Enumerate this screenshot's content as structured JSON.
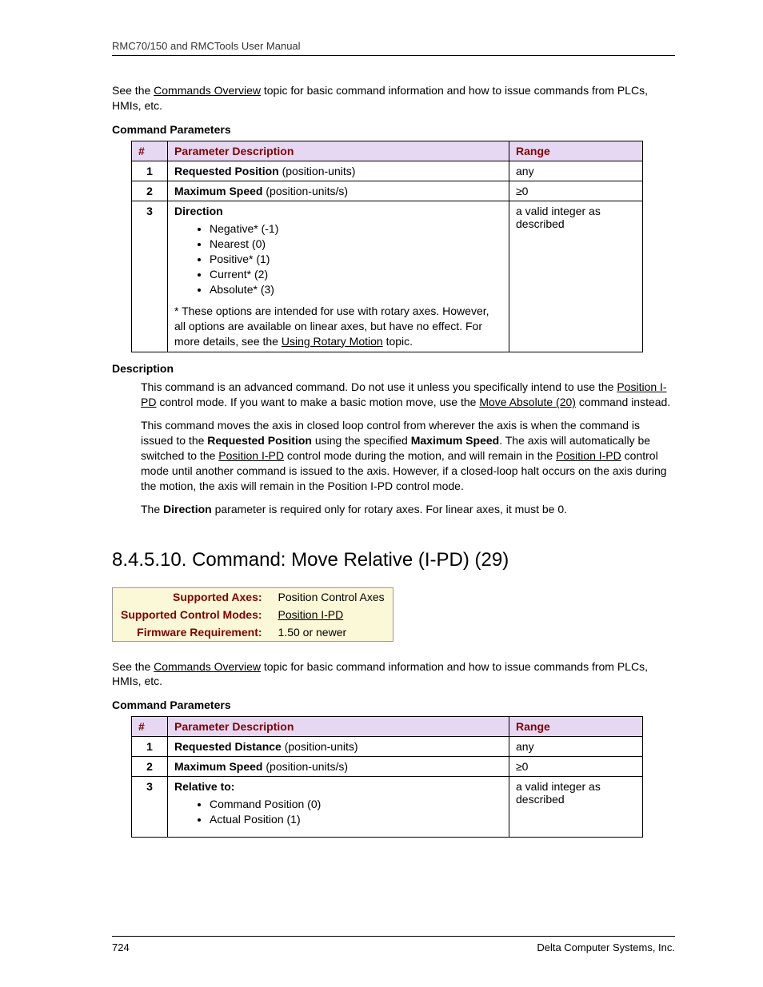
{
  "header": {
    "title": "RMC70/150 and RMCTools User Manual"
  },
  "intro": {
    "seeThe": "See the ",
    "commandsOverview": "Commands Overview",
    "afterLink": " topic for basic command information and how to issue commands from PLCs, HMIs, etc."
  },
  "section1": {
    "paramsHeading": "Command Parameters",
    "table": {
      "h1": "#",
      "h2": "Parameter Description",
      "h3": "Range",
      "r1": {
        "n": "1",
        "name": "Requested Position",
        "unit": "  (position-units)",
        "range": "any"
      },
      "r2": {
        "n": "2",
        "name": "Maximum Speed",
        "unit": "  (position-units/s)",
        "range": "≥0"
      },
      "r3": {
        "n": "3",
        "name": "Direction",
        "opts": [
          "Negative* (-1)",
          "Nearest (0)",
          "Positive* (1)",
          "Current* (2)",
          "Absolute* (3)"
        ],
        "foot_a": "* These options are intended for use with rotary axes. However, all options are available on linear axes, but have no effect. For more details, see the ",
        "foot_link": "Using Rotary Motion",
        "foot_b": " topic.",
        "range": "a valid integer as described"
      }
    },
    "descHeading": "Description",
    "desc": {
      "p1a": "This command is an advanced command. Do not use it unless you specifically intend to use the ",
      "p1link1": "Position I-PD",
      "p1b": " control mode. If you want to make a basic motion move, use the ",
      "p1link2": "Move Absolute (20)",
      "p1c": " command instead.",
      "p2a": "This command moves the axis in closed loop control from wherever the axis is when the command is issued to the ",
      "p2b1": "Requested Position",
      "p2c": " using the specified ",
      "p2b2": "Maximum Speed",
      "p2d": ". The axis will automatically be switched to the ",
      "p2link1": "Position I-PD",
      "p2e": " control mode during the motion, and will remain in the ",
      "p2link2": "Position I-PD",
      "p2f": " control mode until another command is issued to the axis. However, if a closed-loop halt occurs on the axis during the motion, the axis will remain in the Position I-PD control mode.",
      "p3a": "The ",
      "p3b": "Direction",
      "p3c": " parameter is required only for rotary axes. For linear axes, it must be 0."
    }
  },
  "section2": {
    "title": "8.4.5.10. Command: Move Relative (I-PD) (29)",
    "info": {
      "l1": "Supported Axes:",
      "v1": "Position Control Axes",
      "l2": "Supported Control Modes:",
      "v2": "Position I-PD",
      "l3": "Firmware Requirement:",
      "v3": "1.50 or newer"
    },
    "paramsHeading": "Command Parameters",
    "table": {
      "h1": "#",
      "h2": "Parameter Description",
      "h3": "Range",
      "r1": {
        "n": "1",
        "name": "Requested Distance",
        "unit": " (position-units)",
        "range": "any"
      },
      "r2": {
        "n": "2",
        "name": "Maximum Speed",
        "unit": "  (position-units/s)",
        "range": "≥0"
      },
      "r3": {
        "n": "3",
        "name": "Relative to:",
        "opts": [
          "Command Position (0)",
          "Actual Position (1)"
        ],
        "range": "a valid integer as described"
      }
    }
  },
  "footer": {
    "page": "724",
    "company": "Delta Computer Systems, Inc."
  }
}
